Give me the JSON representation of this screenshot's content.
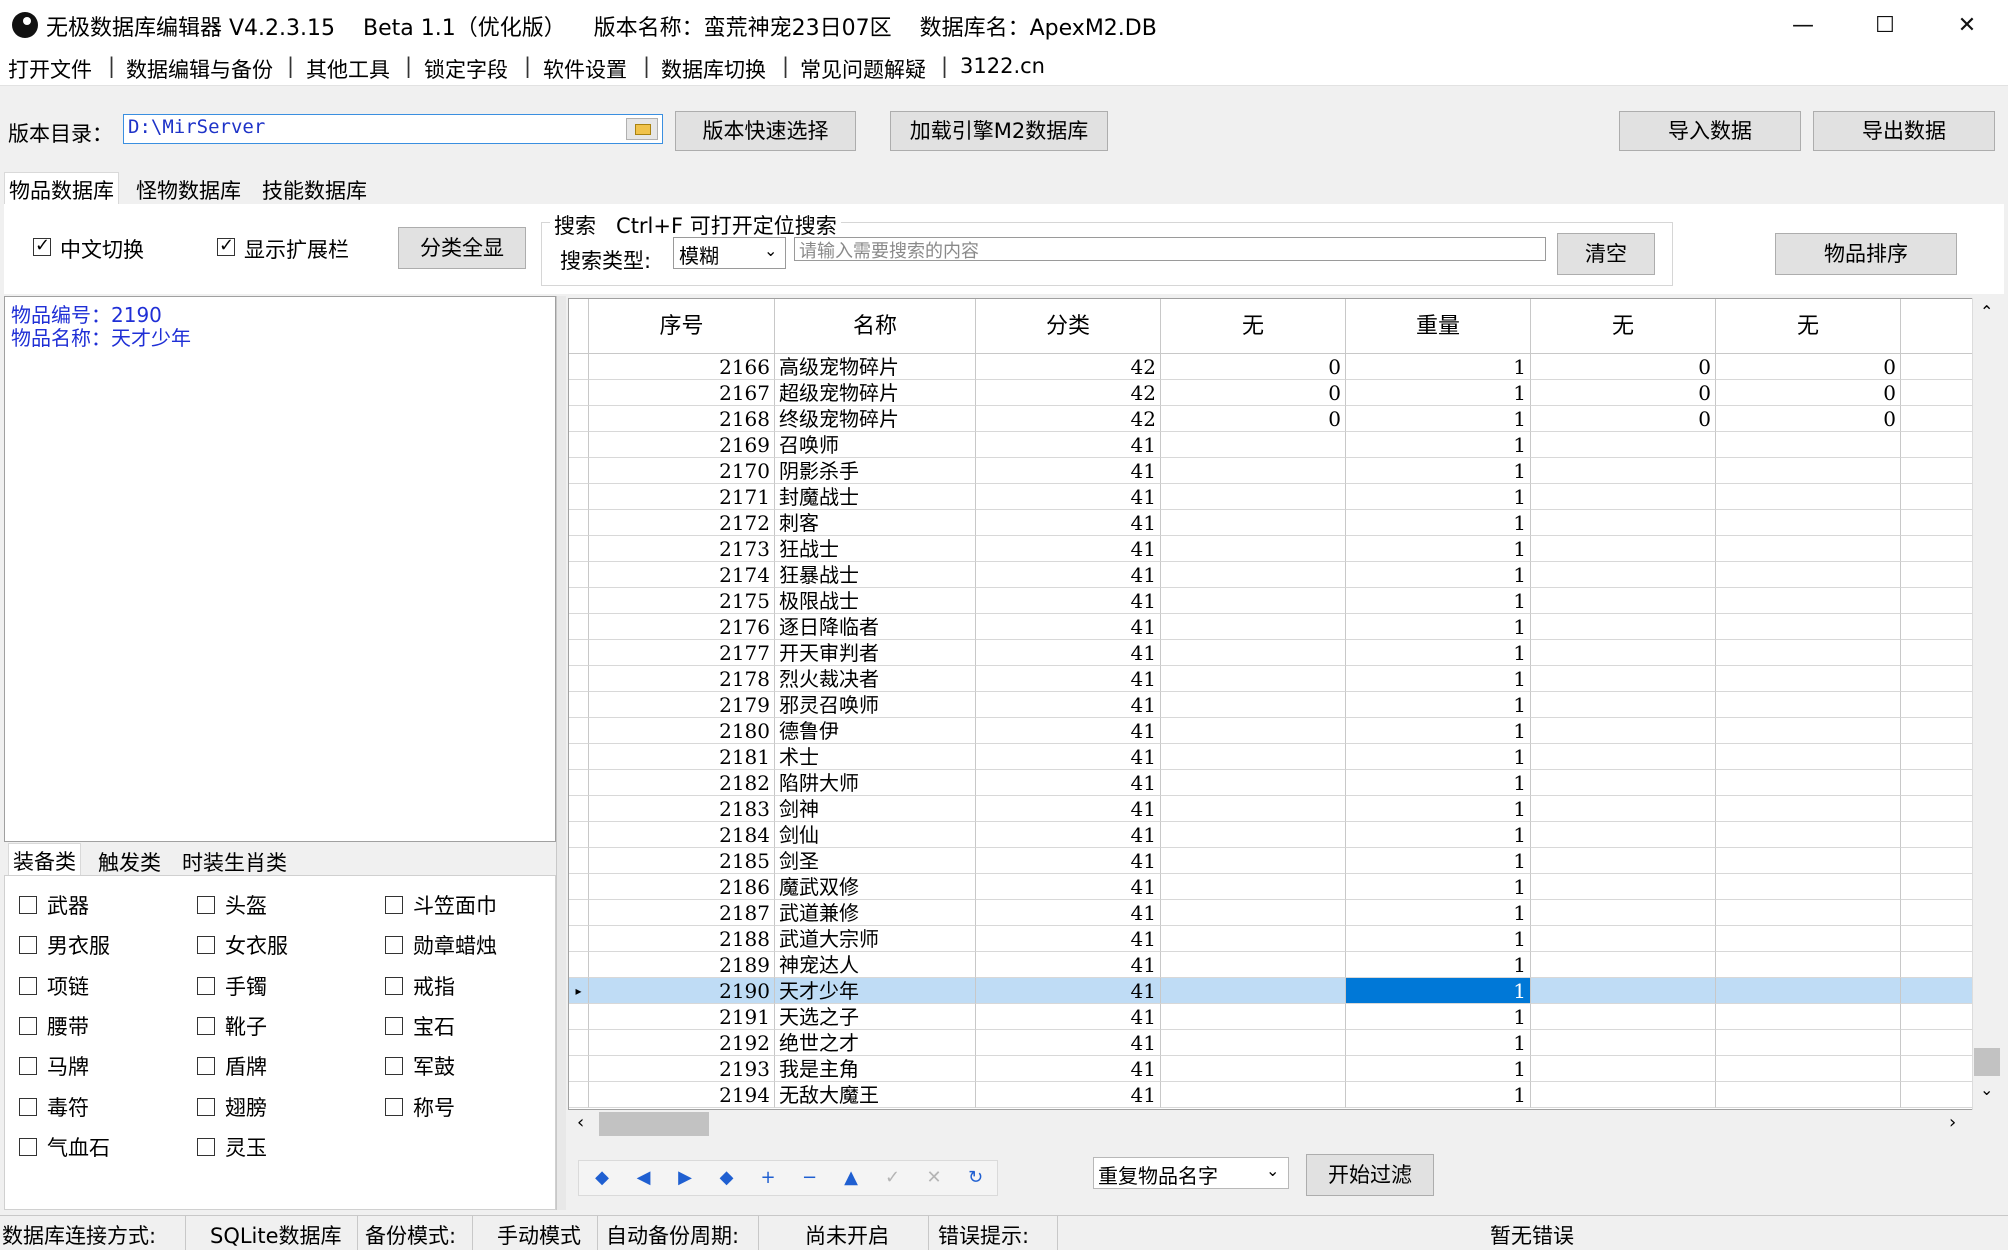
{
  "window": {
    "title": "无极数据库编辑器 V4.2.3.15    Beta 1.1（优化版）    版本名称：蛮荒神宠23日07区    数据库名：ApexM2.DB",
    "minimize": "—",
    "maximize": "☐",
    "close": "✕"
  },
  "menu": {
    "items": [
      "打开文件",
      "数据编辑与备份",
      "其他工具",
      "锁定字段",
      "软件设置",
      "数据库切换",
      "常见问题解疑",
      "3122.cn"
    ],
    "separator": "|"
  },
  "toolbar": {
    "dir_label": "版本目录：",
    "dir_value": "D:\\MirServer",
    "quick_select": "版本快速选择",
    "load_engine": "加载引擎M2数据库",
    "import": "导入数据",
    "export": "导出数据"
  },
  "db_tabs": [
    "物品数据库",
    "怪物数据库",
    "技能数据库"
  ],
  "options": {
    "cn_switch": "中文切换",
    "show_ext": "显示扩展栏",
    "show_all": "分类全显"
  },
  "search": {
    "group_title": "搜索   Ctrl+F 可打开定位搜索",
    "type_label": "搜索类型:",
    "type_value": "模糊",
    "placeholder": "请输入需要搜索的内容",
    "clear": "清空"
  },
  "sort_button": "物品排序",
  "info": {
    "line1": "物品编号：2190",
    "line2": "物品名称：天才少年"
  },
  "category_tabs": [
    "装备类",
    "触发类",
    "时装生肖类"
  ],
  "categories": [
    [
      "武器",
      "头盔",
      "斗笠面巾"
    ],
    [
      "男衣服",
      "女衣服",
      "勋章蜡烛"
    ],
    [
      "项链",
      "手镯",
      "戒指"
    ],
    [
      "腰带",
      "靴子",
      "宝石"
    ],
    [
      "马牌",
      "盾牌",
      "军鼓"
    ],
    [
      "毒符",
      "翅膀",
      "称号"
    ],
    [
      "气血石",
      "灵玉",
      ""
    ]
  ],
  "grid": {
    "columns": [
      "序号",
      "名称",
      "分类",
      "无",
      "重量",
      "无",
      "无"
    ],
    "selected_id": "2190",
    "rows": [
      [
        "2166",
        "高级宠物碎片",
        "42",
        "0",
        "1",
        "0",
        "0"
      ],
      [
        "2167",
        "超级宠物碎片",
        "42",
        "0",
        "1",
        "0",
        "0"
      ],
      [
        "2168",
        "终级宠物碎片",
        "42",
        "0",
        "1",
        "0",
        "0"
      ],
      [
        "2169",
        "召唤师",
        "41",
        "",
        "1",
        "",
        ""
      ],
      [
        "2170",
        "阴影杀手",
        "41",
        "",
        "1",
        "",
        ""
      ],
      [
        "2171",
        "封魔战士",
        "41",
        "",
        "1",
        "",
        ""
      ],
      [
        "2172",
        "刺客",
        "41",
        "",
        "1",
        "",
        ""
      ],
      [
        "2173",
        "狂战士",
        "41",
        "",
        "1",
        "",
        ""
      ],
      [
        "2174",
        "狂暴战士",
        "41",
        "",
        "1",
        "",
        ""
      ],
      [
        "2175",
        "极限战士",
        "41",
        "",
        "1",
        "",
        ""
      ],
      [
        "2176",
        "逐日降临者",
        "41",
        "",
        "1",
        "",
        ""
      ],
      [
        "2177",
        "开天审判者",
        "41",
        "",
        "1",
        "",
        ""
      ],
      [
        "2178",
        "烈火裁决者",
        "41",
        "",
        "1",
        "",
        ""
      ],
      [
        "2179",
        "邪灵召唤师",
        "41",
        "",
        "1",
        "",
        ""
      ],
      [
        "2180",
        "德鲁伊",
        "41",
        "",
        "1",
        "",
        ""
      ],
      [
        "2181",
        "术士",
        "41",
        "",
        "1",
        "",
        ""
      ],
      [
        "2182",
        "陷阱大师",
        "41",
        "",
        "1",
        "",
        ""
      ],
      [
        "2183",
        "剑神",
        "41",
        "",
        "1",
        "",
        ""
      ],
      [
        "2184",
        "剑仙",
        "41",
        "",
        "1",
        "",
        ""
      ],
      [
        "2185",
        "剑圣",
        "41",
        "",
        "1",
        "",
        ""
      ],
      [
        "2186",
        "魔武双修",
        "41",
        "",
        "1",
        "",
        ""
      ],
      [
        "2187",
        "武道兼修",
        "41",
        "",
        "1",
        "",
        ""
      ],
      [
        "2188",
        "武道大宗师",
        "41",
        "",
        "1",
        "",
        ""
      ],
      [
        "2189",
        "神宠达人",
        "41",
        "",
        "1",
        "",
        ""
      ],
      [
        "2190",
        "天才少年",
        "41",
        "",
        "1",
        "",
        ""
      ],
      [
        "2191",
        "天选之子",
        "41",
        "",
        "1",
        "",
        ""
      ],
      [
        "2192",
        "绝世之才",
        "41",
        "",
        "1",
        "",
        ""
      ],
      [
        "2193",
        "我是主角",
        "41",
        "",
        "1",
        "",
        ""
      ],
      [
        "2194",
        "无敌大魔王",
        "41",
        "",
        "1",
        "",
        ""
      ]
    ]
  },
  "navigator": [
    "first",
    "prior",
    "next",
    "last",
    "insert",
    "delete",
    "edit",
    "post",
    "cancel",
    "refresh"
  ],
  "navigator_glyphs": [
    "◆",
    "◀",
    "▶",
    "◆",
    "+",
    "−",
    "▲",
    "✓",
    "✕",
    "↻"
  ],
  "filter": {
    "select_value": "重复物品名字",
    "start": "开始过滤"
  },
  "status": {
    "conn_label": "数据库连接方式:",
    "conn_value": "SQLite数据库",
    "backup_label": "备份模式:",
    "backup_value": "手动模式",
    "auto_label": "自动备份周期:",
    "auto_value": "尚未开启",
    "error_label": "错误提示:",
    "error_value": "暂无错误"
  }
}
